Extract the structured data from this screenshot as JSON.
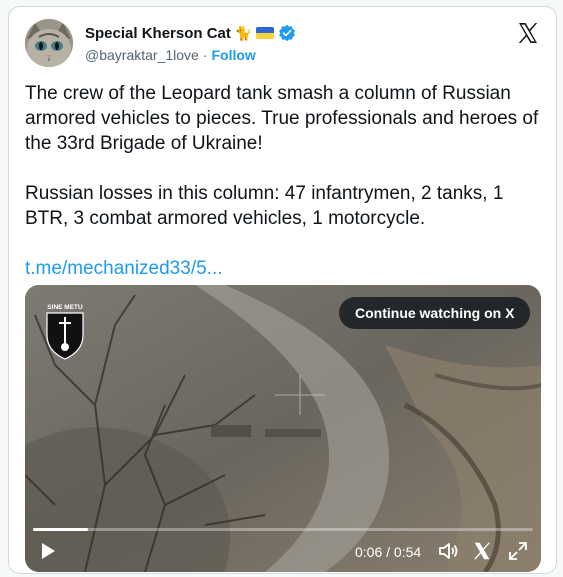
{
  "author": {
    "display_name": "Special Kherson Cat",
    "handle": "@bayraktar_1love",
    "separator": "·",
    "follow_label": "Follow"
  },
  "tweet": {
    "paragraph_1": "The crew of the Leopard tank smash a column of Russian armored vehicles to pieces. True professionals and heroes of the 33rd Brigade of Ukraine!",
    "paragraph_2": "Russian losses in this column: 47 infantrymen, 2 tanks, 1 BTR, 3 combat armored vehicles, 1 motorcycle.",
    "link_text": "t.me/mechanized33/5..."
  },
  "video": {
    "continue_label": "Continue watching on X",
    "badge_text": "SINE METU",
    "current_time": "0:06",
    "time_separator": " / ",
    "duration": "0:54",
    "progress_fraction": 0.11
  },
  "colors": {
    "accent": "#1d9bf0",
    "text": "#0f1419",
    "secondary_text": "#536471",
    "border": "#cfd9de"
  },
  "icons": [
    "cat-emoji-icon",
    "ukraine-flag-icon",
    "verified-badge-icon",
    "x-logo-icon",
    "play-icon",
    "volume-icon",
    "x-watermark-icon",
    "fullscreen-icon"
  ]
}
